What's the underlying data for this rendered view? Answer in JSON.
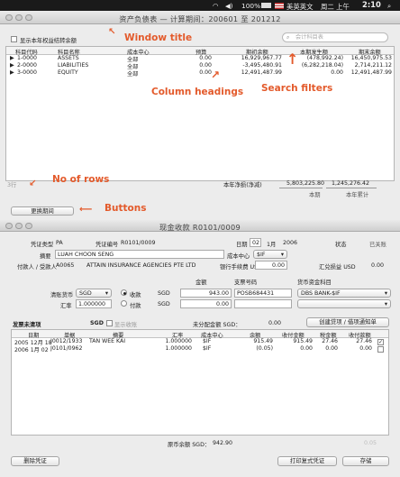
{
  "menubar": {
    "items": [
      "100%",
      "美英英文",
      "周二 上午",
      "2:10"
    ]
  },
  "balance_window": {
    "title": "资产负债表 — 计算期间：200601 至 201212",
    "show_zero_label": "显示本年权益结转余额",
    "search_placeholder": "会计科目表",
    "columns": [
      "科目代码",
      "科目名称",
      "成本中心",
      "预算",
      "期初余额",
      "本期发生额",
      "期末余额"
    ],
    "rows": [
      {
        "code": "1-0000",
        "name": "ASSETS",
        "center": "全部",
        "budget": "0.00",
        "opening": "16,929,967.77",
        "change": "(478,992.24)",
        "closing": "16,450,975.53"
      },
      {
        "code": "2-0000",
        "name": "LIABILITIES",
        "center": "全部",
        "budget": "0.00",
        "opening": "-3,495,480.91",
        "change": "(6,282,218.04)",
        "closing": "2,714,211.12"
      },
      {
        "code": "3-0000",
        "name": "EQUITY",
        "center": "全部",
        "budget": "0.00",
        "opening": "12,491,487.99",
        "change": "0.00",
        "closing": "12,491,487.99"
      }
    ],
    "row_count": "3行",
    "net_profit_label": "本年净损(净减)",
    "net_profit_current": "5,803,225.80",
    "net_profit_ytd": "1,245,276.42",
    "footer_col1": "本期",
    "footer_col2": "本年累计",
    "change_period_button": "更换期间"
  },
  "annotations": {
    "window_title": "Window title",
    "column_headings": "Column headings",
    "search_filters": "Search filters",
    "no_of_rows": "No of rows",
    "buttons": "Buttons"
  },
  "receipt_window": {
    "title": "现金收款 R0101/0009",
    "voucher_type_label": "凭证类型",
    "voucher_type": "PA",
    "voucher_no_label": "凭证编号",
    "voucher_no": "R0101/0009",
    "date_label": "日期",
    "date_day": "02",
    "date_month": "1月",
    "date_year": "2006",
    "status_label": "状态",
    "status": "已关账",
    "summary_label": "摘要",
    "summary": "LUAH CHOON SENG",
    "cost_center_label": "成本中心",
    "cost_center": "$IF",
    "payer_label": "付款人 / 受款人",
    "payer_code": "A0065",
    "payer_name": "ATTAIN INSURANCE AGENCIES PTE LTD",
    "bank_fee_label": "银行手续费 USD",
    "bank_fee": "0.00",
    "fx_gain_label": "汇兑损益 USD",
    "fx_gain": "0.00",
    "amount_label": "金额",
    "cheque_label": "支票号码",
    "currency_account_label": "货币资金科目",
    "currency_label": "清账货币",
    "currency": "SGD",
    "receive_label": "收款",
    "pay_label": "付款",
    "amount_currency": "SGD",
    "amount": "943.00",
    "cheque_no": "POSB684431",
    "bank_account": "DBS BANK-$IF",
    "rate_label": "汇率",
    "rate": "1.000000",
    "amount2_currency": "SGD",
    "amount2": "0.00",
    "unapplied_label": "发票未清项",
    "unapplied_currency": "SGD",
    "show_received_label": "显示收账",
    "unallocated_label": "未分配金额 SGD：",
    "unallocated": "0.00",
    "create_button": "创建贷项 / 借项通知单",
    "grid_columns": [
      "日期",
      "单据",
      "摘要",
      "汇率",
      "成本中心",
      "余额",
      "收付金额",
      "税金额",
      "收付款额"
    ],
    "grid_rows": [
      {
        "date": "2005 12月 18",
        "doc": "J0012/1933",
        "desc": "TAN WEE KAI",
        "rate": "1.000000",
        "center": "$IF",
        "balance": "915.49",
        "paid": "915.49",
        "tax": "27.46",
        "total": "27.46",
        "checked": true
      },
      {
        "date": "2006 1月 02",
        "doc": "J0101/0962",
        "desc": "",
        "rate": "1.000000",
        "center": "$IF",
        "balance": "(0.05)",
        "paid": "0.00",
        "tax": "0.00",
        "total": "0.00",
        "checked": false
      }
    ],
    "original_amount_label": "原币余额 SGD：",
    "original_amount": "942.90",
    "delete_button": "删除凭证",
    "print_button": "打印复式凭证",
    "save_button": "存储",
    "footer_ghost": "0.05"
  },
  "colors": {
    "annotation": "#e35a2b",
    "menubar": "#1a1a1a"
  }
}
